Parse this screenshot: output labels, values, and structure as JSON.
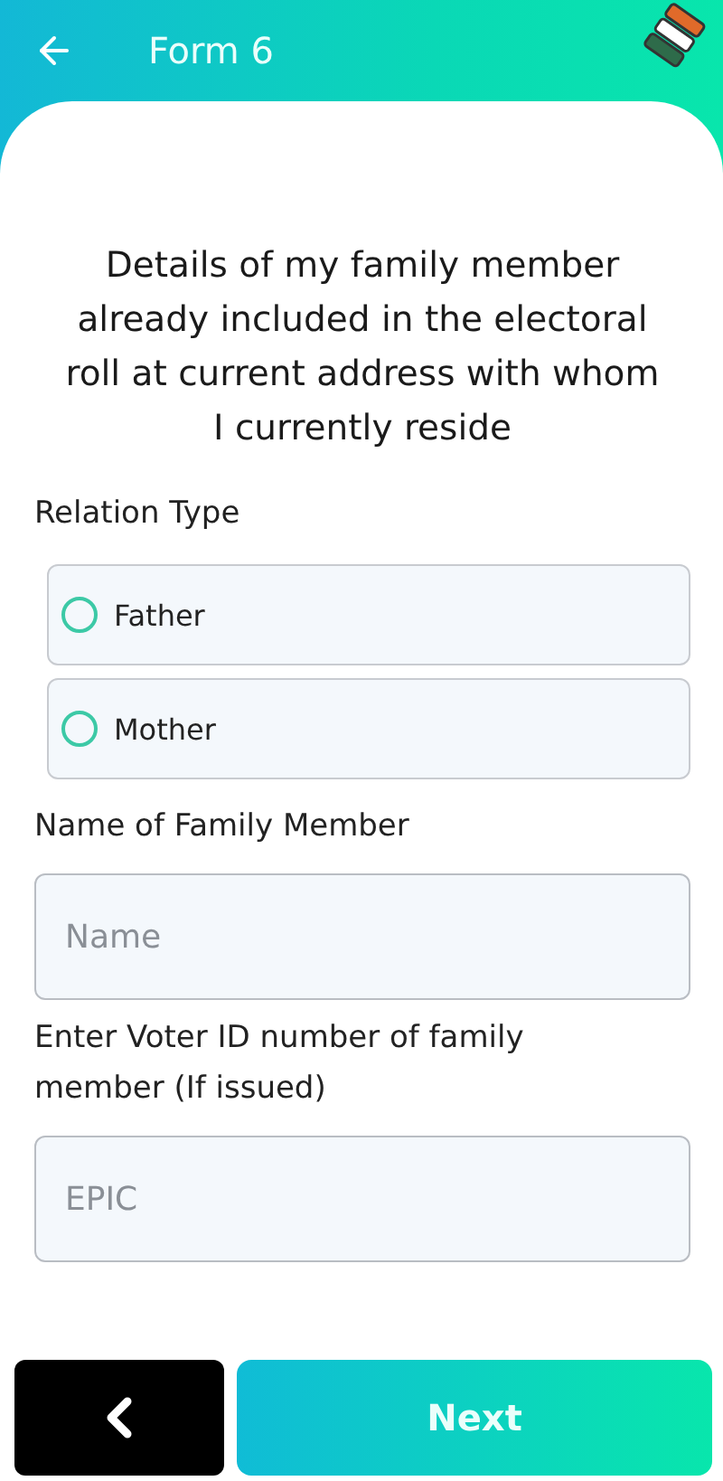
{
  "header": {
    "title": "Form 6"
  },
  "heading": "Details of my family member already included in the electoral roll at current address with whom I currently reside",
  "relation": {
    "label": "Relation Type",
    "options": [
      {
        "label": "Father",
        "selected": false
      },
      {
        "label": "Mother",
        "selected": false
      }
    ]
  },
  "name_field": {
    "label": "Name of Family Member",
    "placeholder": "Name"
  },
  "epic_field": {
    "label": "Enter Voter ID number of family member (If issued)",
    "placeholder": "EPIC"
  },
  "footer": {
    "next": "Next"
  }
}
